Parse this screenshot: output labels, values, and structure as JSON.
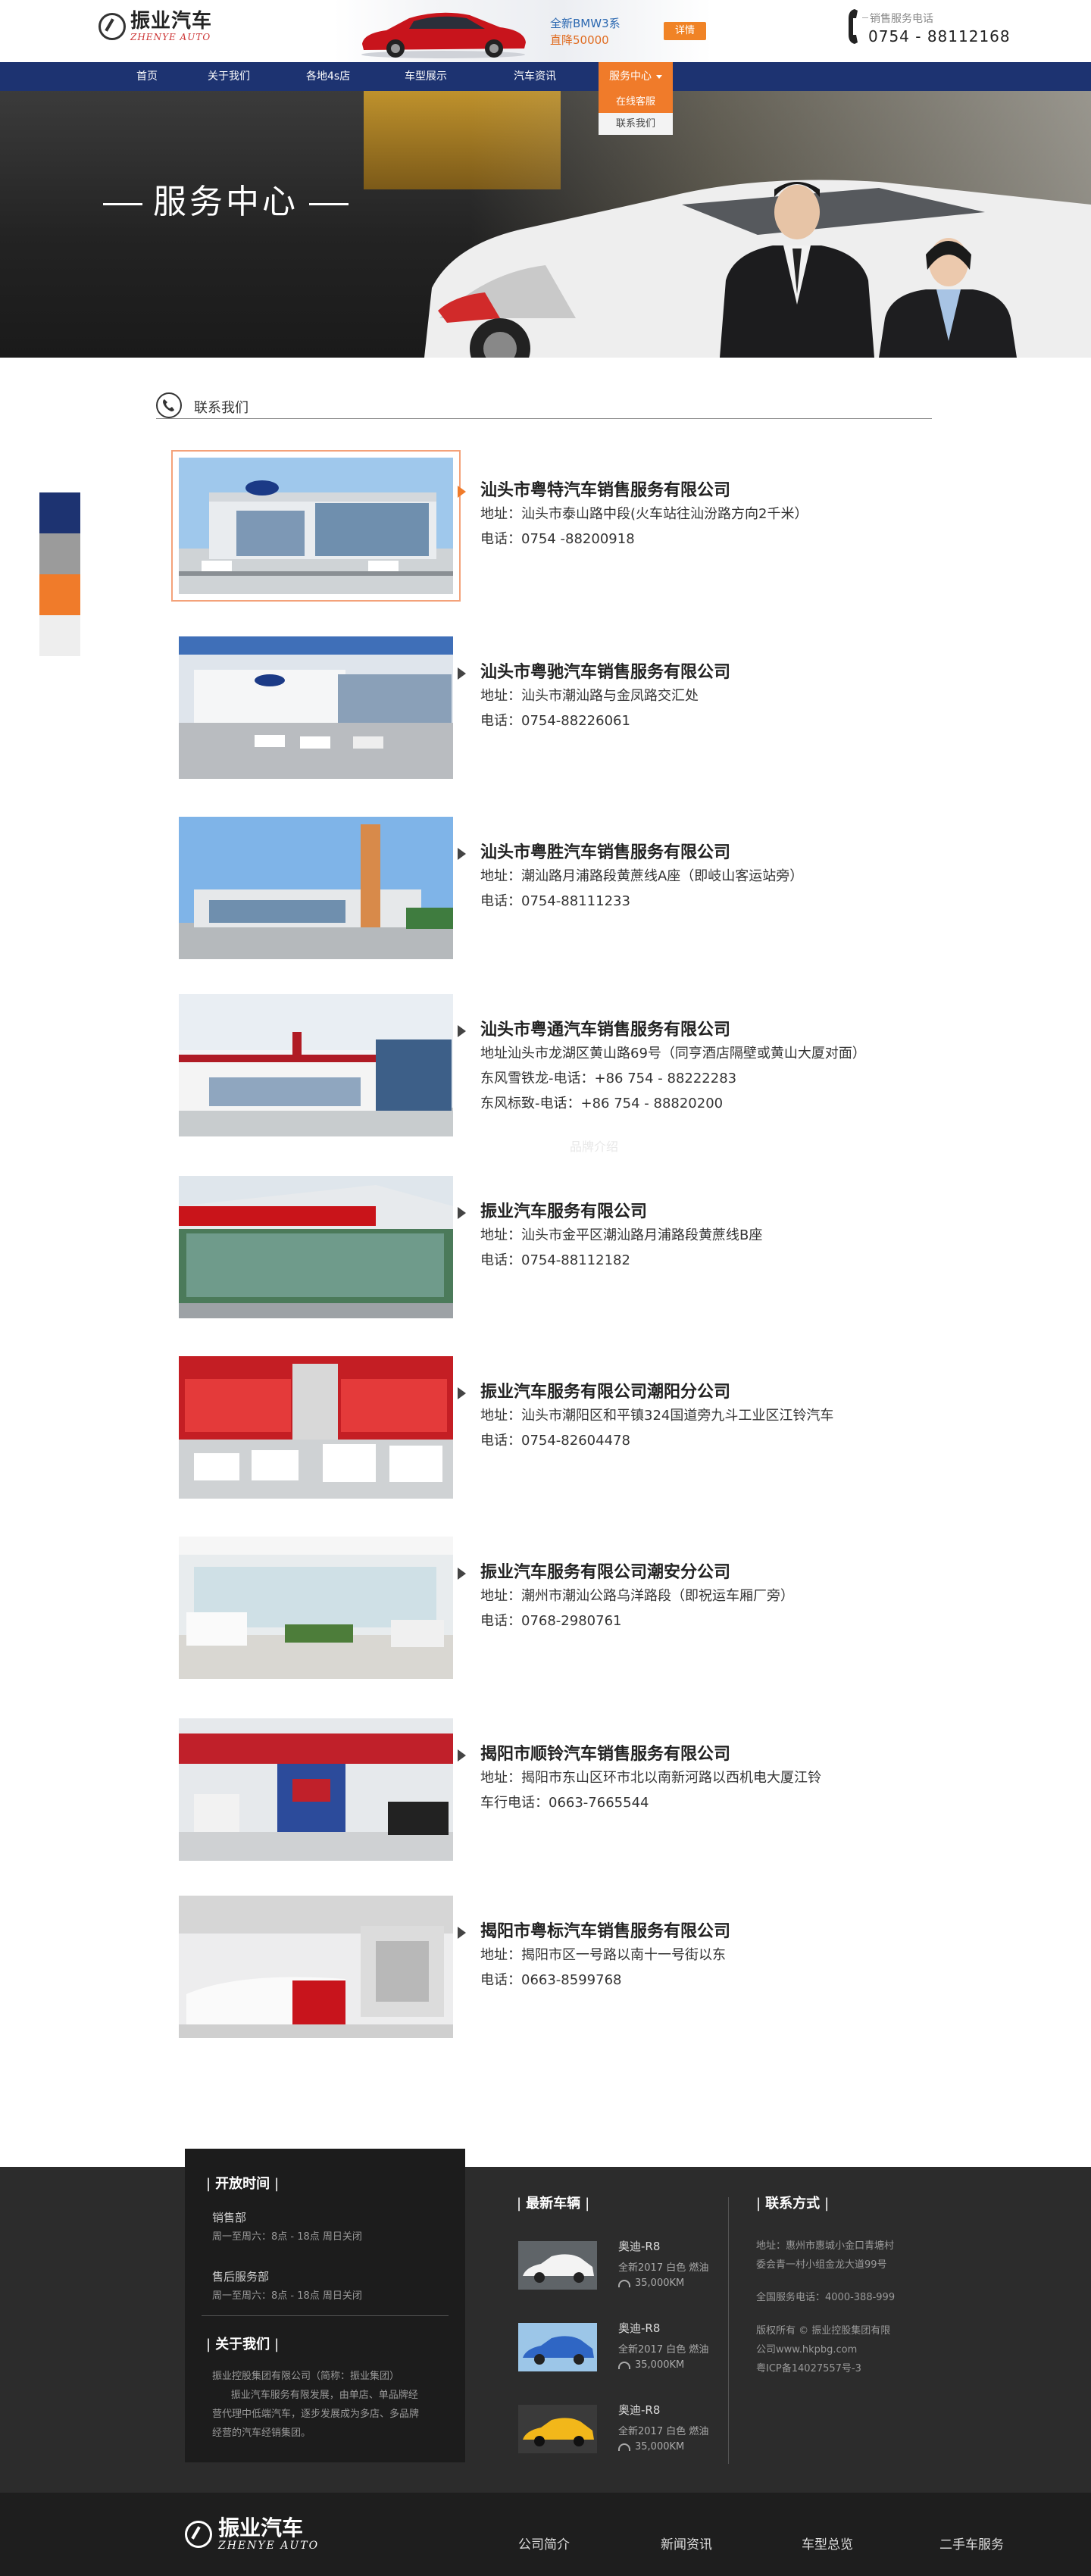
{
  "header": {
    "logo_cn": "振业汽车",
    "logo_en": "ZHENYE AUTO",
    "ad_line1": "全新BMW3系",
    "ad_line2": "直降50000",
    "ad_button": "详情",
    "phone_label": "销售服务电话",
    "phone_number": "0754 - 88112168"
  },
  "nav": {
    "items": [
      {
        "label": "首页"
      },
      {
        "label": "关于我们"
      },
      {
        "label": "各地4s店"
      },
      {
        "label": "车型展示"
      },
      {
        "label": "汽车资讯"
      },
      {
        "label": "服务中心"
      }
    ],
    "dropdown": [
      {
        "label": "在线客服"
      },
      {
        "label": "联系我们"
      }
    ]
  },
  "hero": {
    "title": "服务中心"
  },
  "section": {
    "title": "联系我们"
  },
  "dealers": [
    {
      "name": "汕头市粤特汽车销售服务有限公司",
      "lines": [
        "地址：汕头市泰山路中段(火车站往汕汾路方向2千米）",
        "电话：0754 -88200918"
      ]
    },
    {
      "name": "汕头市粤驰汽车销售服务有限公司",
      "lines": [
        "地址：汕头市潮汕路与金凤路交汇处",
        "电话：0754-88226061"
      ]
    },
    {
      "name": "汕头市粤胜汽车销售服务有限公司",
      "lines": [
        "地址：潮汕路月浦路段黄蔗线A座（即岐山客运站旁）",
        "电话：0754-88111233"
      ]
    },
    {
      "name": "汕头市粤通汽车销售服务有限公司",
      "lines": [
        "地址汕头市龙湖区黄山路69号（同亨酒店隔壁或黄山大厦对面）",
        "东风雪铁龙-电话：+86 754 - 88222283",
        "东风标致-电话：+86 754 - 88820200"
      ]
    },
    {
      "name": "振业汽车服务有限公司",
      "lines": [
        "地址：汕头市金平区潮汕路月浦路段黄蔗线B座",
        "电话：0754-88112182"
      ]
    },
    {
      "name": "振业汽车服务有限公司潮阳分公司",
      "lines": [
        "地址：汕头市潮阳区和平镇324国道旁九斗工业区江铃汽车",
        "电话：0754-82604478"
      ]
    },
    {
      "name": "振业汽车服务有限公司潮安分公司",
      "lines": [
        "地址：潮州市潮汕公路乌洋路段（即祝运车厢厂旁）",
        "电话：0768-2980761"
      ]
    },
    {
      "name": "揭阳市顺铃汽车销售服务有限公司",
      "lines": [
        "地址：揭阳市东山区环市北以南新河路以西机电大厦江铃",
        "车行电话：0663-7665544"
      ]
    },
    {
      "name": "揭阳市粤标汽车销售服务有限公司",
      "lines": [
        "地址：揭阳市区一号路以南十一号街以东",
        "电话：0663-8599768"
      ]
    }
  ],
  "watermark": "品牌介绍",
  "footer": {
    "hours": {
      "heading": "开放时间",
      "sales_title": "销售部",
      "sales_time": "周一至周六：8点 - 18点    周日关闭",
      "after_title": "售后服务部",
      "after_time": "周一至周六：8点 - 18点    周日关闭"
    },
    "about": {
      "heading": "关于我们",
      "lines": [
        "振业控股集团有限公司（简称：振业集团）",
        "      振业汽车服务有限发展，由单店、单品牌经",
        "营代理中低端汽车，逐步发展成为多店、多品牌",
        "经营的汽车经销集团。"
      ]
    },
    "cars": {
      "heading": "最新车辆",
      "items": [
        {
          "name": "奥迪-R8",
          "spec": "全新2017  白色  燃油",
          "km": "35,000KM"
        },
        {
          "name": "奥迪-R8",
          "spec": "全新2017  白色  燃油",
          "km": "35,000KM"
        },
        {
          "name": "奥迪-R8",
          "spec": "全新2017  白色  燃油",
          "km": "35,000KM"
        }
      ]
    },
    "contact": {
      "heading": "联系方式",
      "addr1": "地址：惠州市惠城小金口青塘村",
      "addr2": "委会青一村小组金龙大道99号",
      "hotline": "全国服务电话：4000-388-999",
      "copy1": "版权所有 © 振业控股集团有限",
      "copy2": "公司www.hkpbg.com",
      "icp": "粤ICP备14027557号-3"
    }
  },
  "bottom": {
    "logo_cn": "振业汽车",
    "logo_en": "ZHENYE AUTO",
    "links": [
      {
        "label": "公司简介"
      },
      {
        "label": "新闻资讯"
      },
      {
        "label": "车型总览"
      },
      {
        "label": "二手车服务"
      }
    ]
  },
  "colors": {
    "nav": "#1d3371",
    "accent": "#f07b2a",
    "footer": "#2c2c2c",
    "side_tabs": [
      "#1d3371",
      "#9b9b9b",
      "#f07b2a",
      "#eeeeee"
    ]
  }
}
